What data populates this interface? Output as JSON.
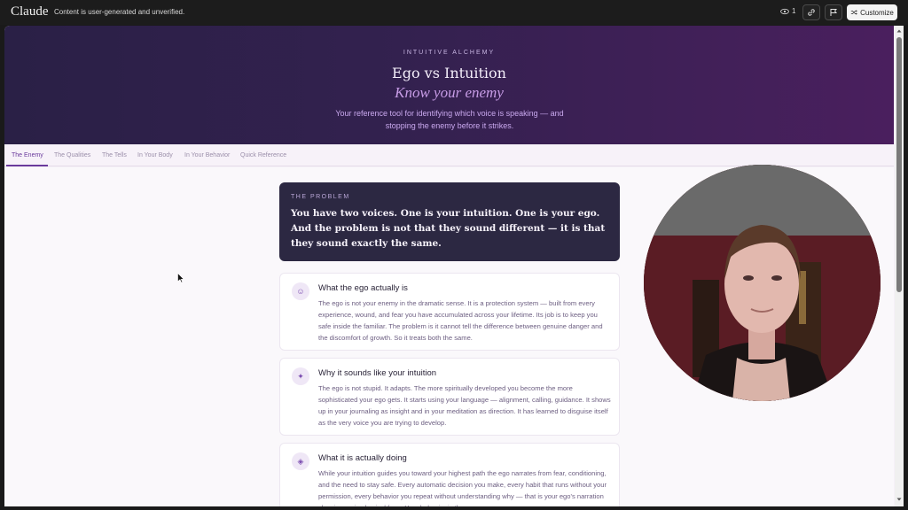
{
  "topbar": {
    "brand": "Claude",
    "notice": "Content is user-generated and unverified.",
    "viewer_count": "1",
    "customize_label": "Customize",
    "icons": [
      "eye-icon",
      "link-icon",
      "flag-icon",
      "shuffle-icon"
    ]
  },
  "hero": {
    "eyebrow": "INTUITIVE ALCHEMY",
    "title": "Ego vs Intuition",
    "subtitle": "Know your enemy",
    "description": "Your reference tool for identifying which voice is speaking — and stopping the enemy before it strikes."
  },
  "tabs": [
    {
      "label": "The Enemy",
      "active": true
    },
    {
      "label": "The Qualities",
      "active": false
    },
    {
      "label": "The Tells",
      "active": false
    },
    {
      "label": "In Your Body",
      "active": false
    },
    {
      "label": "In Your Behavior",
      "active": false
    },
    {
      "label": "Quick Reference",
      "active": false
    }
  ],
  "problem": {
    "eyebrow": "THE PROBLEM",
    "text": "You have two voices. One is your intuition. One is your ego. And the problem is not that they sound different — it is that they sound exactly the same."
  },
  "cards": [
    {
      "icon": "☺",
      "icon_name": "smile-icon",
      "title": "What the ego actually is",
      "body": "The ego is not your enemy in the dramatic sense. It is a protection system — built from every experience, wound, and fear you have accumulated across your lifetime. Its job is to keep you safe inside the familiar. The problem is it cannot tell the difference between genuine danger and the discomfort of growth. So it treats both the same."
    },
    {
      "icon": "✦",
      "icon_name": "sparkle-icon",
      "title": "Why it sounds like your intuition",
      "body": "The ego is not stupid. It adapts. The more spiritually developed you become the more sophisticated your ego gets. It starts using your language — alignment, calling, guidance. It shows up in your journaling as insight and in your meditation as direction. It has learned to disguise itself as the very voice you are trying to develop."
    },
    {
      "icon": "◈",
      "icon_name": "diamond-icon",
      "title": "What it is actually doing",
      "body": "While your intuition guides you toward your highest path the ego narrates from fear, conditioning, and the need to stay safe. Every automatic decision you make, every habit that runs without your permission, every behavior you repeat without understanding why — that is your ego's narration showing up in physical form. Your behavior is the"
    }
  ],
  "colors": {
    "accent": "#6a3a9c",
    "hero_start": "#2a2046",
    "hero_end": "#4a1f5e",
    "problem_bg": "#2c2842"
  }
}
